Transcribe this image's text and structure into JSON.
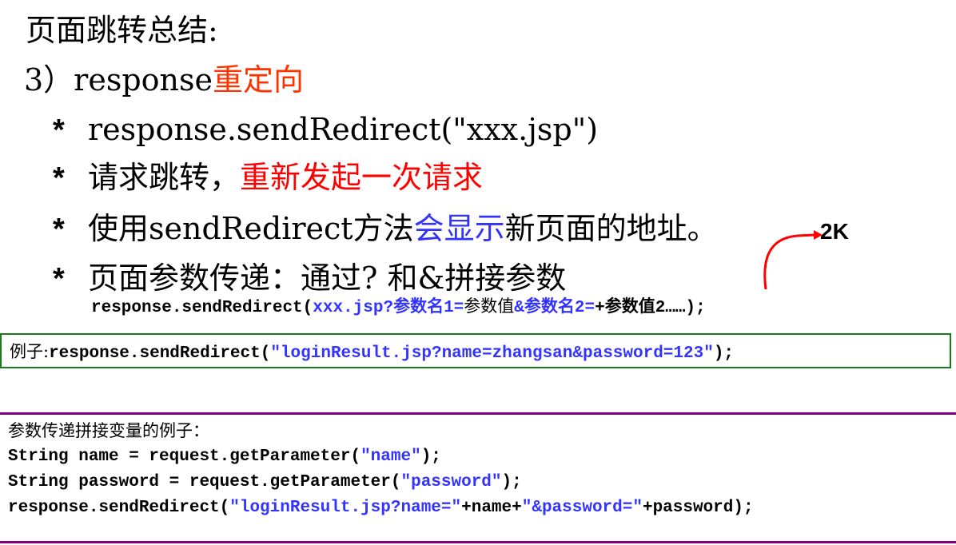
{
  "slide": {
    "title": "页面跳转总结:",
    "section": {
      "prefix": "3）response",
      "highlight": "重定向"
    },
    "bullets": [
      {
        "star": "*",
        "text": "response.sendRedirect(\"xxx.jsp\")"
      },
      {
        "star": "*",
        "text_a": "请求跳转，",
        "text_b": "重新发起一次请求"
      },
      {
        "star": "*",
        "text_a": "使用sendRedirect方法",
        "text_b": "会显示",
        "text_c": "新页面的地址。"
      },
      {
        "star": "*",
        "text": "页面参数传递：通过? 和&拼接参数"
      }
    ],
    "syntax": {
      "a": "response.sendRedirect(",
      "b": "xxx.jsp?参数名1=",
      "c": "参数值",
      "d": "&参数名2=",
      "e": "+参数值2……);"
    },
    "annotation": {
      "label": "2K",
      "arrow_color": "#ff0000"
    },
    "example": {
      "a": "例子:",
      "b": "response.sendRedirect(",
      "c": "\"loginResult.jsp?name=zhangsan&password=123\"",
      "d": ");"
    },
    "concat_example": {
      "heading": "参数传递拼接变量的例子：",
      "line1": {
        "a": "String name = request.getParameter(",
        "b": "\"name\"",
        "c": ");"
      },
      "line2": {
        "a": "String password = request.getParameter(",
        "b": "\"password\"",
        "c": ");"
      },
      "line3": {
        "a": "response.sendRedirect(",
        "b": "\"loginResult.jsp?name=\"",
        "c": "+name+",
        "d": "\"&password=\"",
        "e": "+password);"
      }
    },
    "colors": {
      "accent_red": "#ff3300",
      "link_blue": "#3333ff",
      "box_green": "#1a7a1a",
      "rule_purple": "#800080"
    }
  }
}
